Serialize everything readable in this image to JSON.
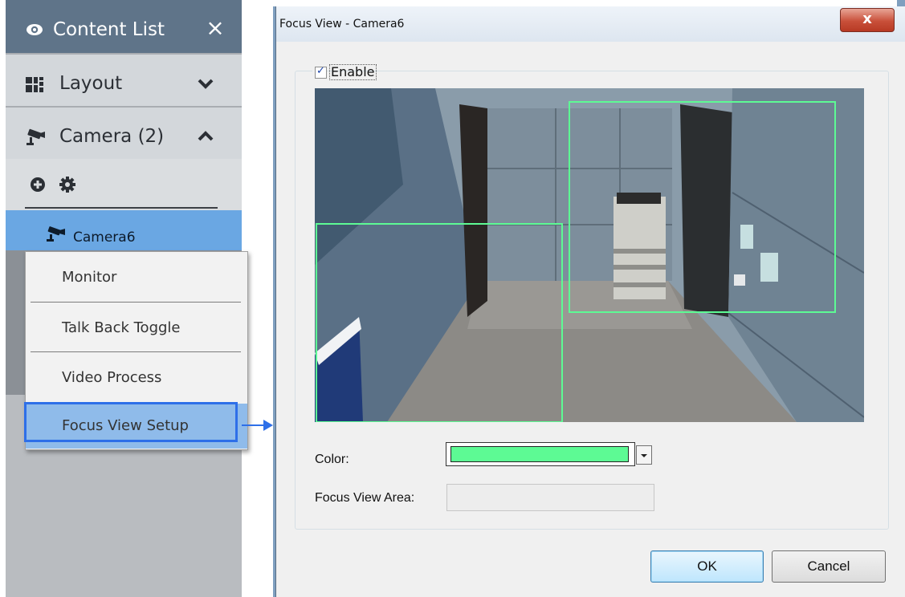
{
  "content_list": {
    "title": "Content List",
    "close": "×",
    "sections": {
      "layout": {
        "label": "Layout",
        "icon": "layout-grid-icon",
        "state": "collapsed"
      },
      "camera": {
        "label": "Camera (2)",
        "icon": "camera-icon",
        "state": "expanded"
      }
    },
    "tools": [
      "add-icon",
      "gear-icon"
    ],
    "selected_camera": "Camera6"
  },
  "context_menu": {
    "items": [
      "Monitor",
      "Talk Back Toggle",
      "Video Process",
      "Focus View Setup"
    ],
    "highlighted": "Focus View Setup"
  },
  "dialog": {
    "title": "Focus View - Camera6",
    "close": "x",
    "enable_label": "Enable",
    "enable_checked": true,
    "color_label": "Color:",
    "color_value": "#5dfa94",
    "area_label": "Focus View Area:",
    "area_value": "",
    "ok_label": "OK",
    "cancel_label": "Cancel"
  },
  "colors": {
    "highlight": "#2e6fe8",
    "focus_rect": "#5dfa94",
    "panel_header": "#5f7489",
    "selected_item": "#6aa7e3"
  }
}
